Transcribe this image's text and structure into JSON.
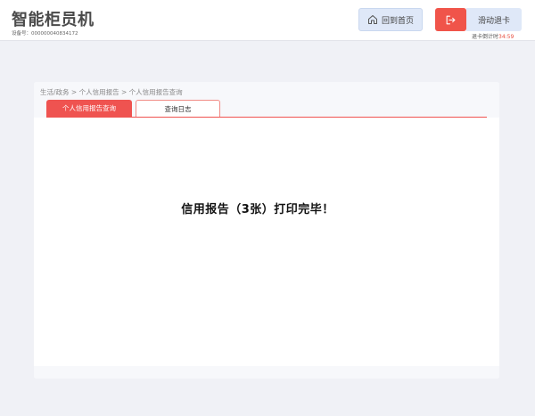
{
  "header": {
    "title": "智能柜员机",
    "device_id": "设备号：000000040834172",
    "home_label": "回到首页",
    "swipe_label": "滑动退卡",
    "countdown_label": "退卡倒计时",
    "countdown_value": "34:59"
  },
  "breadcrumb": "生活/政务 > 个人信用报告 > 个人信用报告查询",
  "tabs": [
    {
      "label": "个人信用报告查询",
      "active": true
    },
    {
      "label": "查询日志",
      "active": false
    }
  ],
  "message": "信用报告（3张）打印完毕！",
  "colors": {
    "accent": "#ef5350",
    "button_bg": "#dfe8f8",
    "exit_bg": "#f0544a",
    "page_bg": "#f0f1f6"
  },
  "icons": {
    "home": "home-icon",
    "exit": "exit-icon"
  }
}
